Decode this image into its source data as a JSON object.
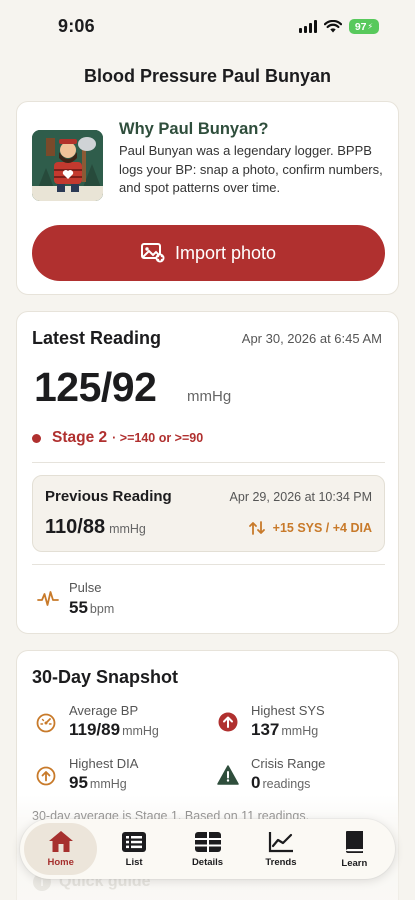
{
  "status": {
    "time": "9:06",
    "battery": "97"
  },
  "page": {
    "title": "Blood Pressure Paul Bunyan"
  },
  "hero": {
    "title": "Why Paul Bunyan?",
    "text": "Paul Bunyan was a legendary logger. BPPB logs your BP: snap a photo, confirm numbers, and spot patterns over time.",
    "import_label": "Import photo"
  },
  "latest": {
    "title": "Latest Reading",
    "date": "Apr 30, 2026 at 6:45 AM",
    "value": "125/92",
    "unit": "mmHg",
    "stage": "Stage 2",
    "criteria": "· >=140 or >=90",
    "previous": {
      "title": "Previous Reading",
      "date": "Apr 29, 2026 at 10:34 PM",
      "value": "110/88",
      "unit": "mmHg",
      "delta": "+15 SYS / +4 DIA"
    },
    "pulse": {
      "label": "Pulse",
      "value": "55",
      "unit": "bpm"
    }
  },
  "snapshot": {
    "title": "30-Day Snapshot",
    "average": {
      "label": "Average BP",
      "value": "119/89",
      "unit": "mmHg"
    },
    "highest_sys": {
      "label": "Highest SYS",
      "value": "137",
      "unit": "mmHg"
    },
    "highest_dia": {
      "label": "Highest DIA",
      "value": "95",
      "unit": "mmHg"
    },
    "crisis": {
      "label": "Crisis Range",
      "value": "0",
      "unit": "readings"
    },
    "footnote": "30-day average is Stage 1. Based on 11 readings."
  },
  "quick_guide": {
    "label": "Quick guide"
  },
  "tabs": [
    {
      "label": "Home",
      "icon": "home-icon"
    },
    {
      "label": "List",
      "icon": "list-icon"
    },
    {
      "label": "Details",
      "icon": "details-icon"
    },
    {
      "label": "Trends",
      "icon": "trends-icon"
    },
    {
      "label": "Learn",
      "icon": "book-icon"
    }
  ],
  "colors": {
    "accent": "#b0302f",
    "forest": "#2f4e3c",
    "warning": "#c87a2a",
    "background": "#f6f4ef"
  }
}
